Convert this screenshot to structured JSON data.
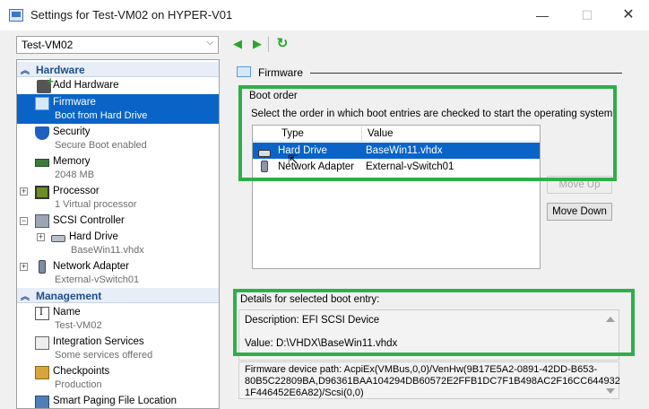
{
  "window": {
    "title": "Settings for Test-VM02 on HYPER-V01",
    "minimize": "—",
    "maximize": "☐",
    "close": "✕"
  },
  "toolbar": {
    "vm_selected": "Test-VM02",
    "back": "◀",
    "forward": "▶",
    "refresh": "↻"
  },
  "tree": {
    "sections": {
      "hardware": "Hardware",
      "management": "Management"
    },
    "hardware_items": [
      {
        "label": "Add Hardware",
        "sub": ""
      },
      {
        "label": "Firmware",
        "sub": "Boot from Hard Drive"
      },
      {
        "label": "Security",
        "sub": "Secure Boot enabled"
      },
      {
        "label": "Memory",
        "sub": "2048 MB"
      },
      {
        "label": "Processor",
        "sub": "1 Virtual processor"
      },
      {
        "label": "SCSI Controller",
        "sub": ""
      },
      {
        "label": "Hard Drive",
        "sub": "BaseWin11.vhdx"
      },
      {
        "label": "Network Adapter",
        "sub": "External-vSwitch01"
      }
    ],
    "management_items": [
      {
        "label": "Name",
        "sub": "Test-VM02"
      },
      {
        "label": "Integration Services",
        "sub": "Some services offered"
      },
      {
        "label": "Checkpoints",
        "sub": "Production"
      },
      {
        "label": "Smart Paging File Location",
        "sub": ""
      }
    ]
  },
  "firmware": {
    "header": "Firmware",
    "boot_order_label": "Boot order",
    "boot_order_desc": "Select the order in which boot entries are checked to start the operating system.",
    "columns": [
      "Type",
      "Value"
    ],
    "entries": [
      {
        "type": "Hard Drive",
        "value": "BaseWin11.vhdx"
      },
      {
        "type": "Network Adapter",
        "value": "External-vSwitch01"
      }
    ],
    "move_up": "Move Up",
    "move_down": "Move Down",
    "details_label": "Details for selected boot entry:",
    "description": "Description: EFI SCSI Device",
    "value": "Value: D:\\VHDX\\BaseWin11.vhdx",
    "path_lines": [
      "Firmware device path: AcpiEx(VMBus,0,0)/VenHw(9B17E5A2-0891-42DD-B653-",
      "80B5C22809BA,D96361BAA104294DB60572E2FFB1DC7F1B498AC2F16CC644932",
      "1F446452E6A82)/Scsi(0,0)"
    ]
  },
  "colors": {
    "selection": "#0a64c8",
    "highlight": "#2fae4a",
    "section_header": "#1f4e8c"
  }
}
